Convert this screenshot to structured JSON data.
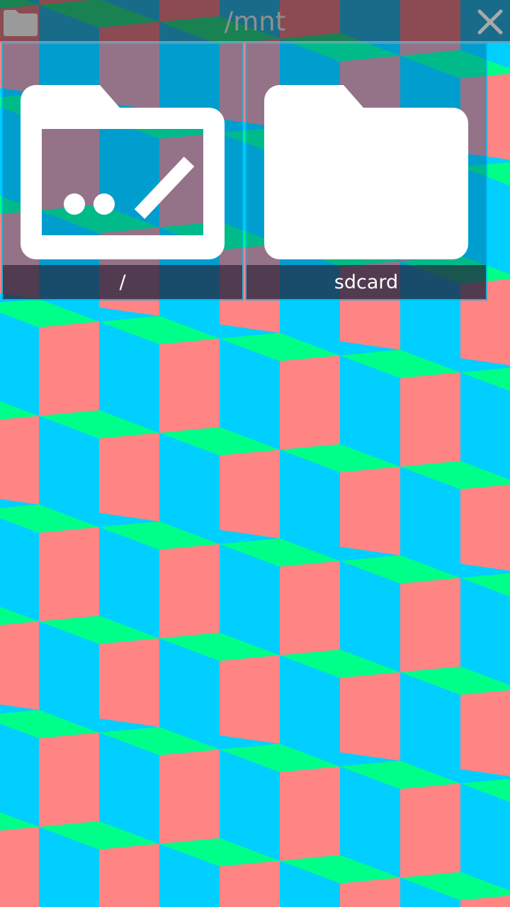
{
  "titlebar": {
    "path": "/mnt",
    "folder_icon": "folder-icon",
    "close_icon": "close-icon"
  },
  "entries": [
    {
      "name": "/",
      "icon": "parent-folder-icon"
    },
    {
      "name": "sdcard",
      "icon": "folder-icon"
    }
  ],
  "colors": {
    "background_pink": "#ff8585",
    "background_blue": "#00cfff",
    "background_green": "#00ff88",
    "icon_white": "#ffffff",
    "title_text": "#8f8f8f"
  }
}
